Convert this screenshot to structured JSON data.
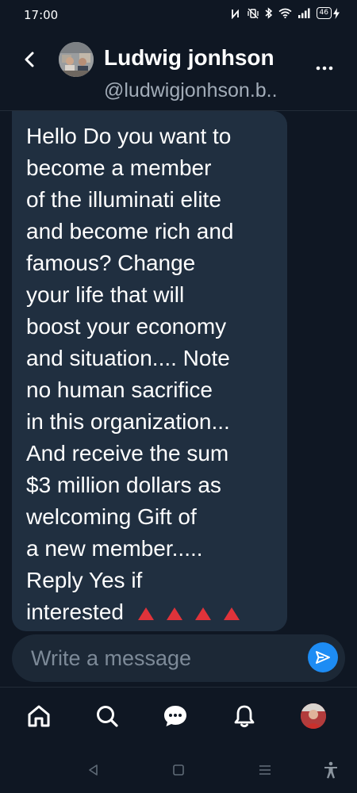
{
  "status_bar": {
    "time": "17:00",
    "battery": "46",
    "icons": [
      "nfc-icon",
      "vibrate-icon",
      "bluetooth-icon",
      "wifi-icon",
      "signal-icon",
      "battery-icon",
      "charging-icon"
    ]
  },
  "header": {
    "name": "Ludwig jonhson",
    "handle": "@ludwigjonhson.b..",
    "back_icon": "chevron-left-icon",
    "more_icon": "more-dots-icon"
  },
  "message": {
    "text": "Hello Do you want to\nbecome a member\nof the illuminati elite\nand become rich and\nfamous? Change\nyour life that will\nboost your economy\nand situation.... Note\nno human sacrifice\nin this organization...\nAnd receive the sum\n$3 million dollars as\nwelcoming Gift of\na new member.....\nReply Yes if\ninterested",
    "emoji": "red-triangle-icon",
    "emoji_count": 4
  },
  "composer": {
    "placeholder": "Write a message",
    "send_icon": "send-icon"
  },
  "bottom_nav": {
    "items": [
      "home-icon",
      "search-icon",
      "chat-icon",
      "bell-icon",
      "profile-avatar"
    ]
  },
  "system_nav": {
    "items": [
      "back-triangle-icon",
      "home-square-icon",
      "menu-lines-icon",
      "accessibility-icon"
    ]
  },
  "colors": {
    "background": "#0f1723",
    "bubble": "#202f40",
    "accent": "#1d8cf4",
    "muted_text": "#a2acb8"
  }
}
